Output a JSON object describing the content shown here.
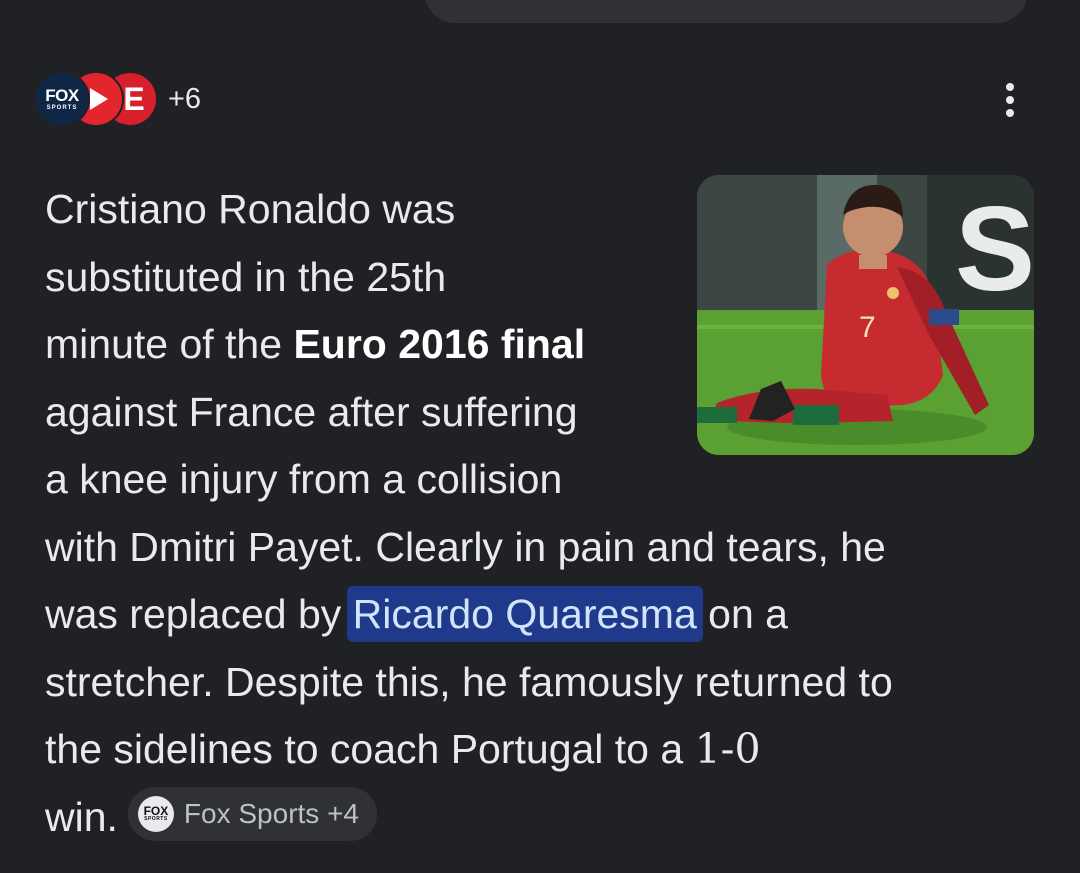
{
  "sources": {
    "logos": [
      {
        "name": "fox-sports-icon",
        "text": "FOX",
        "sub": "SPORTS",
        "color": "#0f2747"
      },
      {
        "name": "red-play-logo-icon",
        "color": "#e3262e"
      },
      {
        "name": "e-logo-icon",
        "text": "E",
        "color": "#d8202c"
      }
    ],
    "more_count": "+6"
  },
  "menu": {
    "icon": "more-vert-icon"
  },
  "thumbnail": {
    "subject": "footballer-sitting-on-pitch",
    "shirt_number": "7",
    "background_letter": "S"
  },
  "answer": {
    "line1": "Cristiano Ronaldo was",
    "line2": "substituted in the 25th",
    "line3_pre": "minute of the ",
    "line3_bold": "Euro 2016 final",
    "line4": "against France after suffering",
    "line5": "a knee injury from a collision",
    "line6": "with Dmitri Payet. Clearly in pain and tears, he",
    "line7_pre": "was replaced by ",
    "line7_link": "Ricardo Quaresma",
    "line7_post": " on a",
    "line8": "stretcher. Despite this, he famously returned to",
    "line9_pre": "the sidelines to coach Portugal to a ",
    "line9_score": "1-0",
    "line10": "win."
  },
  "citation": {
    "logo_text": "FOX",
    "logo_sub": "SPORTS",
    "label": "Fox Sports +4"
  },
  "colors": {
    "background": "#202124",
    "text": "#e8eaed",
    "link_bg": "#1f3a8a",
    "link_text": "#d2e3fc",
    "chip_bg": "#303134"
  }
}
